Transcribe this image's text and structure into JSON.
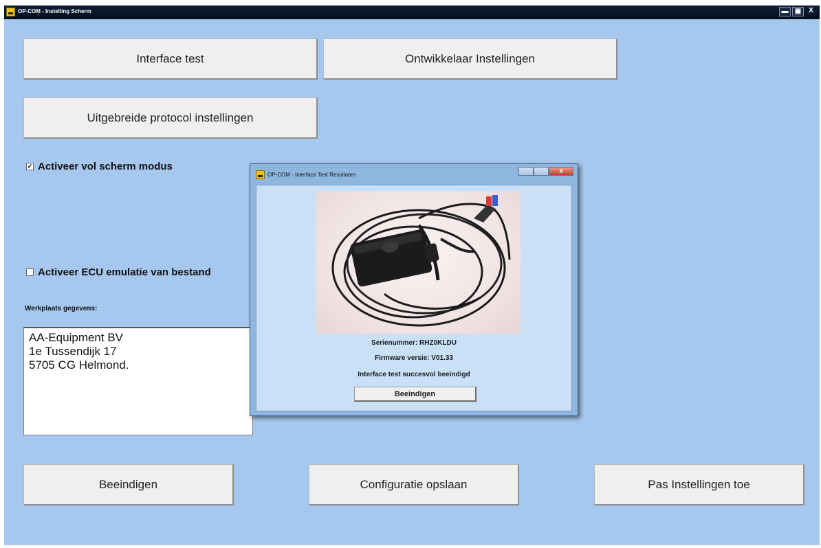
{
  "window": {
    "title": "OP-COM - Instelling Scherm",
    "controls": {
      "minimize": "▬",
      "maximize": "▣",
      "close": "X"
    }
  },
  "buttons": {
    "interface_test": "Interface test",
    "developer_settings": "Ontwikkelaar Instellingen",
    "protocol_settings": "Uitgebreide protocol instellingen",
    "quit": "Beeindigen",
    "save_config": "Configuratie opslaan",
    "apply_settings": "Pas Instellingen toe"
  },
  "options": {
    "fullscreen": {
      "label": "Activeer vol scherm modus",
      "checked": true,
      "mark": "✓"
    },
    "ecu_emulation": {
      "label": "Activeer ECU emulatie van bestand",
      "checked": false,
      "mark": ""
    }
  },
  "workshop": {
    "label": "Werkplaats gegevens:",
    "lines": [
      "AA-Equipment BV",
      "1e Tussendijk 17",
      "5705 CG Helmond."
    ]
  },
  "dialog": {
    "title": "OP-COM - Interface Test Resultaten",
    "serial": "Serienummer: RHZ0KLDU",
    "firmware": "Firmware versie: V01.33",
    "status": "Interface test succesvol beeindigd",
    "close_button": "Beeindigen",
    "controls": {
      "close": "X"
    }
  },
  "colors": {
    "background": "#a6c8ee",
    "titlebar": "#0d2038",
    "button": "#efefef",
    "dialog_body": "#c9e0f6"
  }
}
